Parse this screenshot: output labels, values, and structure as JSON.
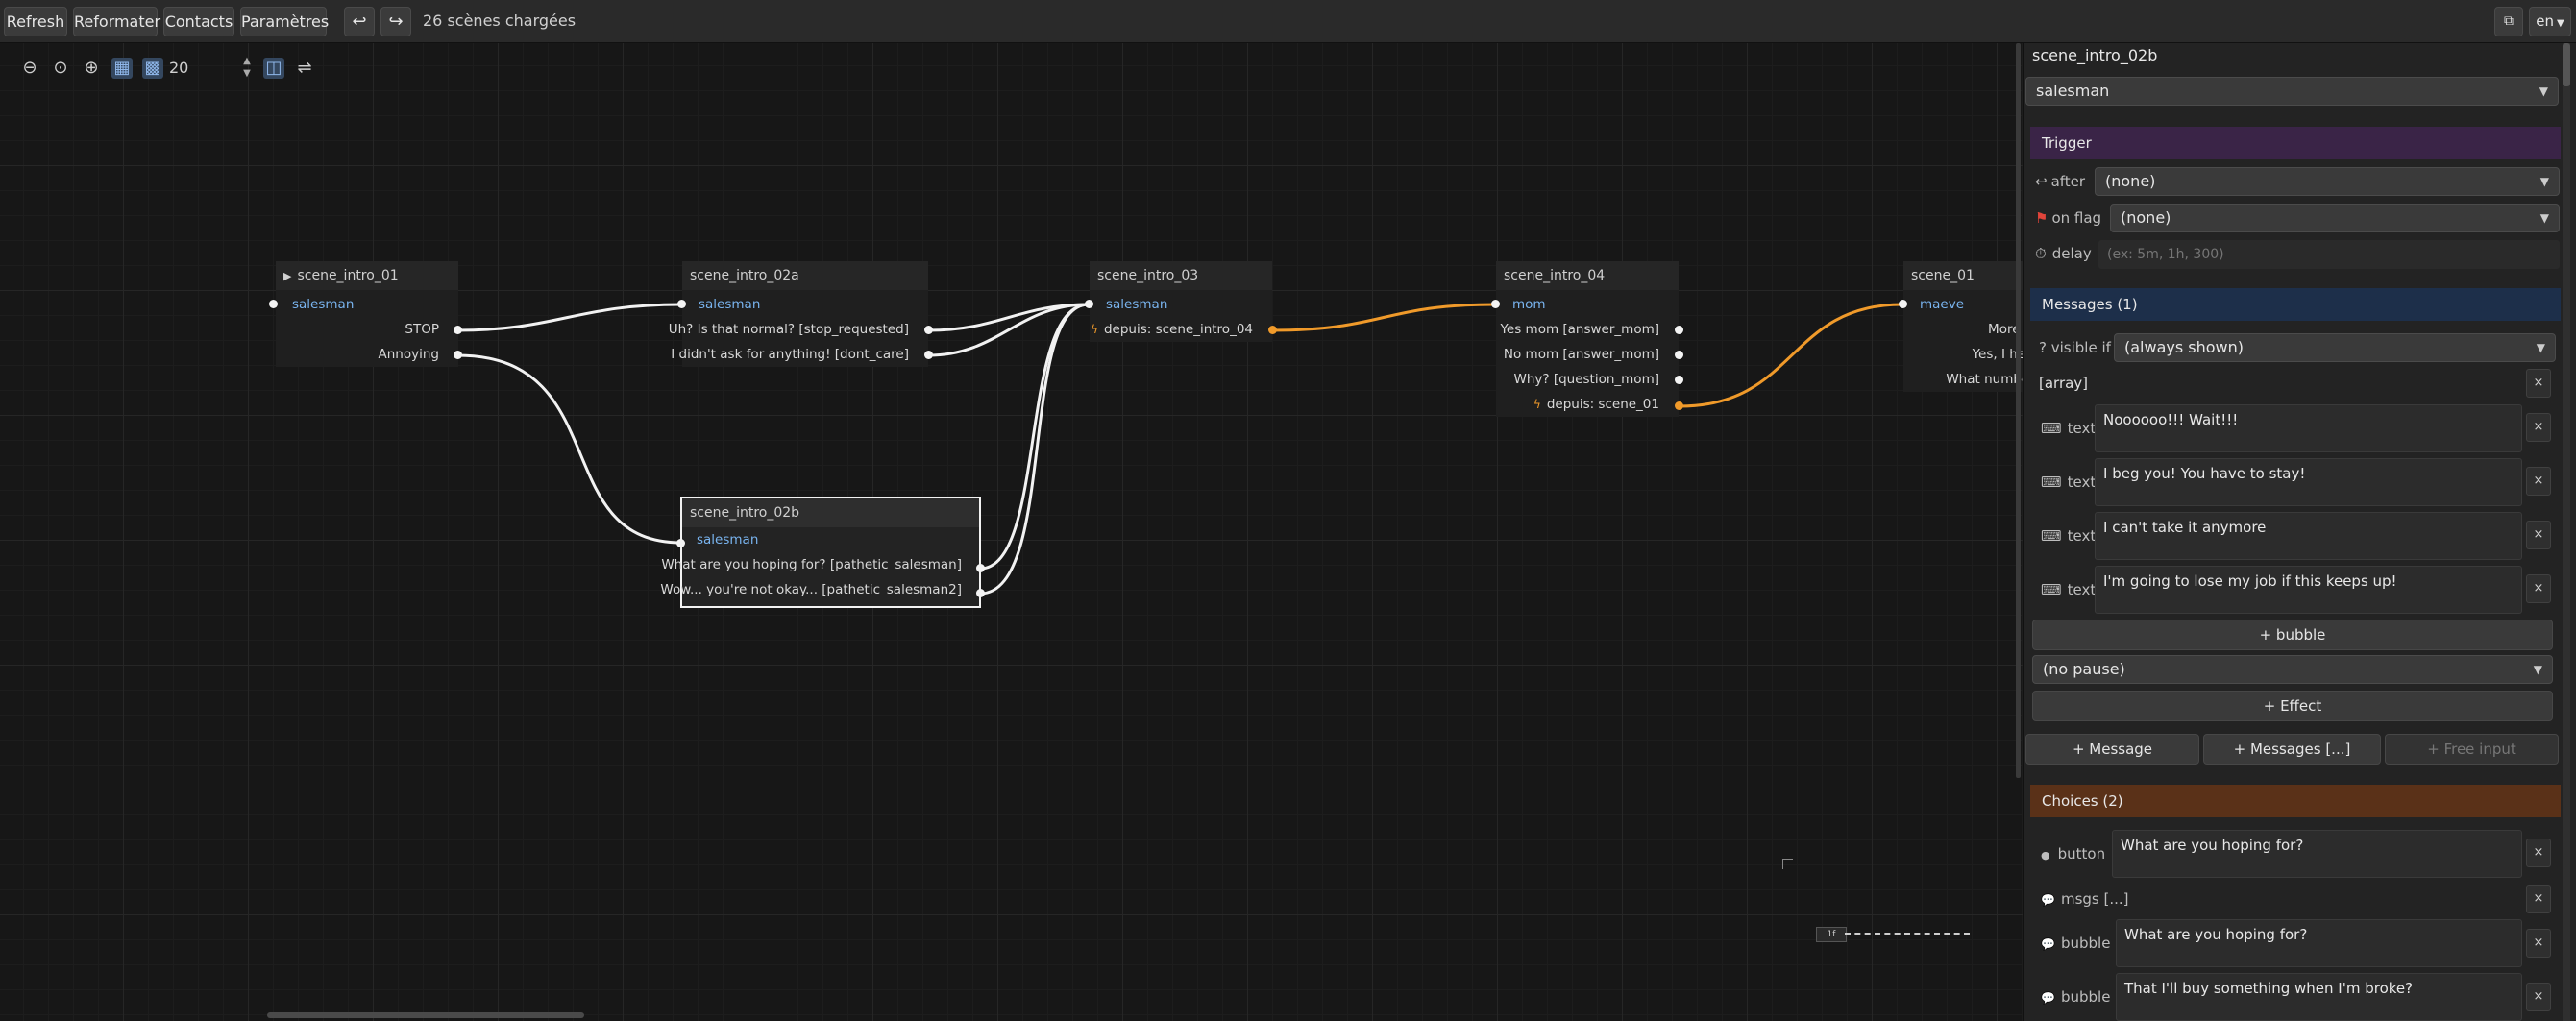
{
  "toolbar": {
    "refresh": "Refresh",
    "reformat": "Reformater",
    "contacts": "Contacts",
    "settings": "Paramètres",
    "undo_icon": "undo-icon",
    "redo_icon": "redo-icon",
    "status": "26 scènes chargées",
    "lang": "en"
  },
  "canvas": {
    "zoom": "20",
    "hidden_label": "1f"
  },
  "nodes": {
    "n1": {
      "title": "scene_intro_01",
      "speaker": "salesman",
      "choices": [
        "STOP",
        "Annoying"
      ]
    },
    "n2": {
      "title": "scene_intro_02a",
      "speaker": "salesman",
      "choices": [
        "Uh? Is that normal?  [stop_requested]",
        "I didn't ask for anything!  [dont_care]"
      ]
    },
    "n3": {
      "title": "scene_intro_03",
      "speaker": "salesman",
      "depuis": "depuis: scene_intro_04"
    },
    "n4": {
      "title": "scene_intro_04",
      "speaker": "mom",
      "choices": [
        "Yes mom  [answer_mom]",
        "No mom  [answer_mom]",
        "Why?  [question_mom]"
      ],
      "depuis": "depuis: scene_01"
    },
    "n5": {
      "title": "scene_01",
      "speaker": "maeve",
      "choices": [
        "More spam?",
        "Yes, I hear you",
        "What number is th"
      ]
    },
    "n6": {
      "title": "scene_intro_02b",
      "speaker": "salesman",
      "choices": [
        "What are you hoping for?  [pathetic_salesman]",
        "Wow... you're not okay...  [pathetic_salesman2]"
      ]
    }
  },
  "panel": {
    "scene_title": "scene_intro_02b",
    "speaker": "salesman",
    "trigger_title": "Trigger",
    "after_label": "after",
    "after_value": "(none)",
    "onflag_label": "on flag",
    "onflag_value": "(none)",
    "delay_label": "delay",
    "delay_placeholder": "(ex: 5m, 1h, 300)",
    "messages_title": "Messages (1)",
    "visible_label": "? visible if",
    "visible_value": "(always shown)",
    "array_label": "[array]",
    "text_label": "text",
    "texts": [
      "Noooooo!!! Wait!!!",
      "I beg you! You have to stay!",
      "I can't take it anymore",
      "I'm going to lose my job if this keeps up!"
    ],
    "add_bubble": "+ bubble",
    "pause_value": "(no pause)",
    "add_effect": "+ Effect",
    "add_message": "+ Message",
    "add_messages": "+ Messages [...]",
    "add_free_input": "+ Free input",
    "choices_title": "Choices (2)",
    "button_label": "button",
    "button_value": "What are you hoping for?",
    "msgs_label": "msgs [...]",
    "bubble_label": "bubble",
    "bubble1": "What are you hoping for?",
    "bubble2": "That I'll buy something when I'm broke?",
    "close": "×"
  },
  "colors": {
    "trigger_bg": "#3a2447",
    "messages_bg": "#1d2f4a",
    "choices_bg": "#5a3118",
    "speaker": "#79b4ef",
    "accent_orange": "#f09a2a"
  }
}
